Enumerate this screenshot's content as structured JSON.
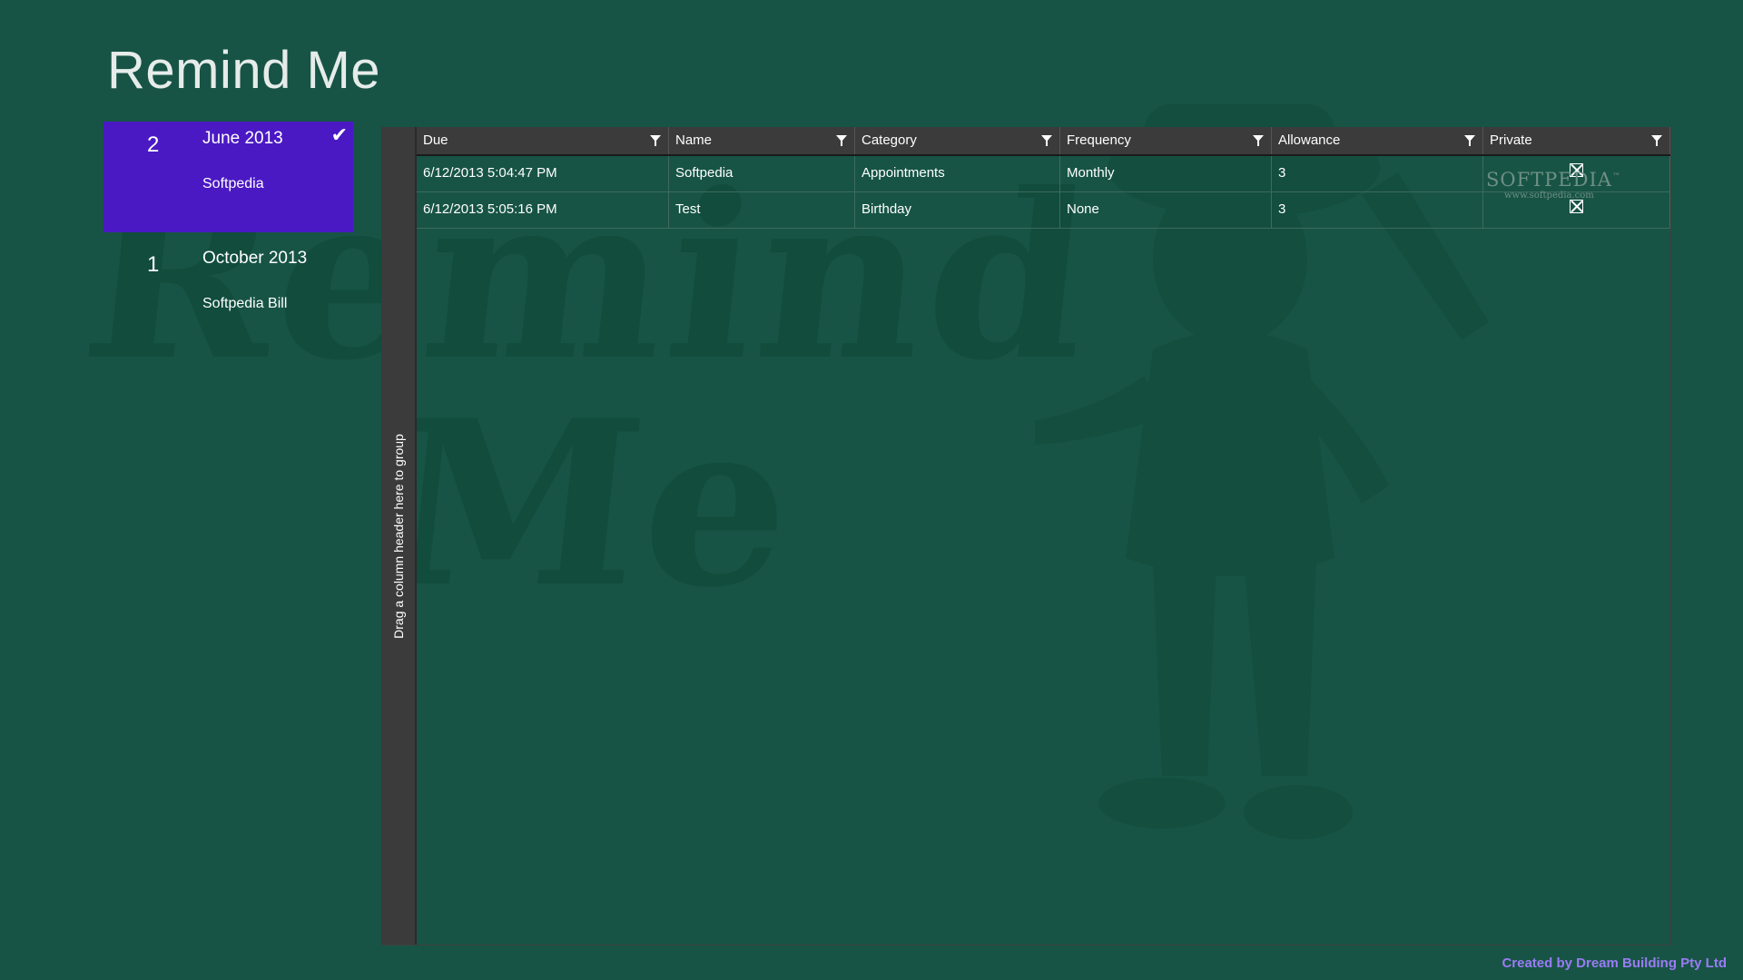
{
  "app": {
    "title": "Remind Me",
    "background_color": "#175445",
    "selected_color": "#4a19c4"
  },
  "groups": [
    {
      "count": "2",
      "month": "June 2013",
      "item": "Softpedia",
      "selected": true,
      "icon": "checkmark-icon"
    },
    {
      "count": "1",
      "month": "October 2013",
      "item": "Softpedia Bill",
      "selected": false
    }
  ],
  "grid": {
    "group_panel_text": "Drag a column header here to group",
    "columns": [
      "Due",
      "Name",
      "Category",
      "Frequency",
      "Allowance",
      "Private"
    ],
    "rows": [
      {
        "due": "6/12/2013 5:04:47 PM",
        "name": "Softpedia",
        "category": "Appointments",
        "frequency": "Monthly",
        "allowance": "3",
        "private": false
      },
      {
        "due": "6/12/2013 5:05:16 PM",
        "name": "Test",
        "category": "Birthday",
        "frequency": "None",
        "allowance": "3",
        "private": false
      }
    ]
  },
  "watermark": {
    "text": "SOFTPEDIA",
    "tm": "™",
    "url": "www.softpedia.com"
  },
  "background_art": {
    "words": [
      "Remind",
      "Me"
    ]
  },
  "footer": {
    "credit": "Created by Dream Building Pty Ltd",
    "credit_color": "#9a7cf4"
  }
}
